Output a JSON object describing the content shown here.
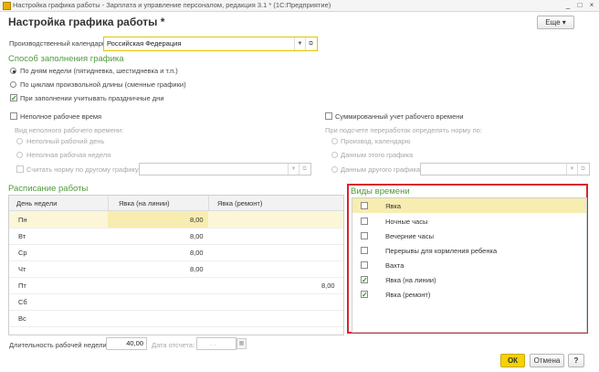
{
  "window": {
    "title": "Настройка графика работы - Зарплата и управление персоналом, редакция 3.1 * (1С:Предприятие)"
  },
  "form": {
    "title": "Настройка графика работы *",
    "more_label": "Еще ▾"
  },
  "calendar": {
    "label": "Производственный календарь:",
    "value": "Российская Федерация"
  },
  "fill_method": {
    "title": "Способ заполнения графика",
    "options": [
      "По дням недели (пятидневка, шестидневка и т.п.)",
      "По циклам произвольной длины (сменные графики)"
    ],
    "selected_index": 0,
    "holidays_label": "При заполнении учитывать праздничные дни",
    "holidays_checked": true
  },
  "part_time": {
    "label": "Неполное рабочее время",
    "kind_label": "Вид неполного рабочего времени:",
    "options": [
      "Неполный рабочий день",
      "Неполная рабочая неделя"
    ],
    "norm_label": "Считать норму по другому графику:"
  },
  "summary": {
    "label": "Суммированный учет рабочего времени",
    "overtime_label": "При подсчете переработок определять норму по:",
    "options": [
      "Производ. календарю",
      "Данным этого графика",
      "Данным другого графика"
    ]
  },
  "schedule": {
    "title": "Расписание работы",
    "columns": [
      "День недели",
      "Явка (на линии)",
      "Явка (ремонт)"
    ],
    "rows": [
      {
        "day": "Пн",
        "line": "8,00",
        "repair": ""
      },
      {
        "day": "Вт",
        "line": "8,00",
        "repair": ""
      },
      {
        "day": "Ср",
        "line": "8,00",
        "repair": ""
      },
      {
        "day": "Чт",
        "line": "8,00",
        "repair": ""
      },
      {
        "day": "Пт",
        "line": "",
        "repair": "8,00"
      },
      {
        "day": "Сб",
        "line": "",
        "repair": ""
      },
      {
        "day": "Вс",
        "line": "",
        "repair": ""
      }
    ]
  },
  "time_types": {
    "title": "Виды времени",
    "items": [
      {
        "label": "Явка",
        "checked": false
      },
      {
        "label": "Ночные часы",
        "checked": false
      },
      {
        "label": "Вечерние часы",
        "checked": false
      },
      {
        "label": "Перерывы для кормления ребенка",
        "checked": false
      },
      {
        "label": "Вахта",
        "checked": false
      },
      {
        "label": "Явка (на линии)",
        "checked": true
      },
      {
        "label": "Явка (ремонт)",
        "checked": true
      }
    ]
  },
  "footer": {
    "week_label": "Длительность рабочей недели:",
    "week_value": "40,00",
    "date_label": "Дата отсчета:",
    "date_value": ". .",
    "ok_label": "ОК",
    "cancel_label": "Отмена",
    "help_label": "?"
  }
}
